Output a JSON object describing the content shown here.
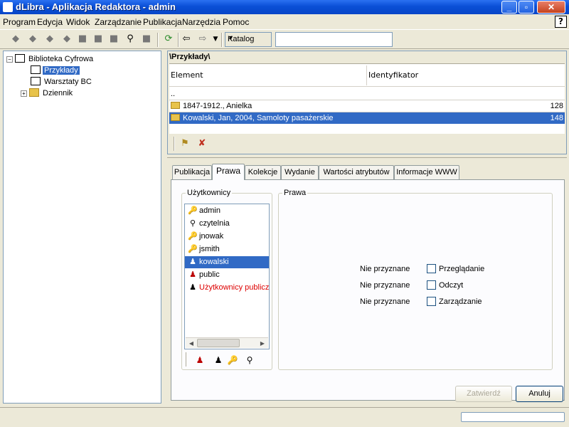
{
  "window": {
    "title": "dLibra - Aplikacja Redaktora - admin"
  },
  "menu": [
    "Program",
    "Edycja",
    "Widok",
    "Zarządzanie",
    "Publikacja",
    "Narzędzia",
    "Pomoc"
  ],
  "toolbar": {
    "catalog_select": "Katalog",
    "search_value": ""
  },
  "tree": {
    "root": "Biblioteka Cyfrowa",
    "children": [
      "Przykłady",
      "Warsztaty BC",
      "Dziennik"
    ]
  },
  "list": {
    "path": "\\Przykłady\\",
    "columns": [
      "Element",
      "Identyfikator"
    ],
    "parent": "..",
    "rows": [
      {
        "element": "1847-1912., Anielka",
        "id": "128"
      },
      {
        "element": "Kowalski, Jan, 2004, Samoloty pasażerskie",
        "id": "148"
      }
    ]
  },
  "tabs": [
    "Publikacja",
    "Prawa",
    "Kolekcje",
    "Wydanie",
    "Wartości atrybutów",
    "Informacje WWW"
  ],
  "users": {
    "legend": "Użytkownicy",
    "items": [
      "admin",
      "czytelnia",
      "jnowak",
      "jsmith",
      "kowalski",
      "public",
      "Użytkownicy publiczni"
    ]
  },
  "rights": {
    "legend": "Prawa",
    "rows": [
      {
        "status": "Nie przyznane",
        "label": "Przeglądanie"
      },
      {
        "status": "Nie przyznane",
        "label": "Odczyt"
      },
      {
        "status": "Nie przyznane",
        "label": "Zarządzanie"
      }
    ]
  },
  "buttons": {
    "apply": "Zatwierdź",
    "cancel": "Anuluj"
  }
}
